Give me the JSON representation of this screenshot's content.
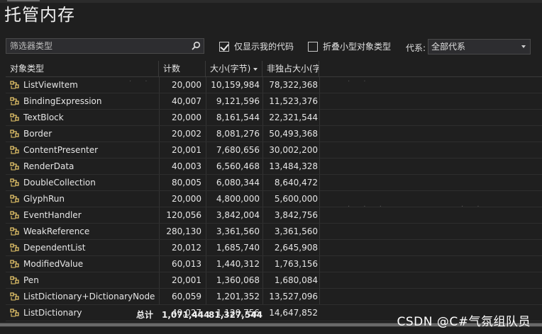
{
  "page": {
    "title": "托管内存"
  },
  "toolbar": {
    "filter_placeholder": "筛选器类型",
    "just_my_code_label": "仅显示我的代码",
    "just_my_code_checked": true,
    "collapse_small_label": "折叠小型对象类型",
    "collapse_small_checked": false,
    "generation_label": "代系:",
    "generation_value": "全部代系"
  },
  "table": {
    "columns": [
      "对象类型",
      "计数",
      "大小(字节)",
      "非独占大小(字"
    ],
    "sorted_column": "大小(字节)",
    "rows": [
      {
        "type": "ListViewItem",
        "count": "20,000",
        "size": "10,159,984",
        "inclusive": "78,322,368"
      },
      {
        "type": "BindingExpression",
        "count": "40,007",
        "size": "9,121,596",
        "inclusive": "11,523,376"
      },
      {
        "type": "TextBlock",
        "count": "20,000",
        "size": "8,161,544",
        "inclusive": "22,321,544"
      },
      {
        "type": "Border",
        "count": "20,002",
        "size": "8,081,276",
        "inclusive": "50,493,368"
      },
      {
        "type": "ContentPresenter",
        "count": "20,001",
        "size": "7,680,656",
        "inclusive": "30,002,200"
      },
      {
        "type": "RenderData",
        "count": "40,003",
        "size": "6,560,468",
        "inclusive": "13,484,328"
      },
      {
        "type": "DoubleCollection",
        "count": "80,005",
        "size": "6,080,344",
        "inclusive": "8,640,472"
      },
      {
        "type": "GlyphRun",
        "count": "20,000",
        "size": "4,800,000",
        "inclusive": "5,600,000"
      },
      {
        "type": "EventHandler",
        "count": "120,056",
        "size": "3,842,004",
        "inclusive": "3,842,756"
      },
      {
        "type": "WeakReference",
        "count": "280,130",
        "size": "3,361,560",
        "inclusive": "3,361,560"
      },
      {
        "type": "DependentList",
        "count": "20,012",
        "size": "1,685,740",
        "inclusive": "2,645,908"
      },
      {
        "type": "ModifiedValue",
        "count": "60,013",
        "size": "1,440,312",
        "inclusive": "1,763,156"
      },
      {
        "type": "Pen",
        "count": "20,001",
        "size": "1,360,068",
        "inclusive": "1,680,084"
      },
      {
        "type": "ListDictionary+DictionaryNode",
        "count": "60,059",
        "size": "1,201,352",
        "inclusive": "13,527,096"
      },
      {
        "type": "ListDictionary",
        "count": "40,027",
        "size": "1,120,756",
        "inclusive": "14,647,852"
      }
    ],
    "total_label": "总计",
    "total_count": "1,071,444",
    "total_size": "81,327,544"
  },
  "watermark": "CSDN @C#气氛组队员",
  "colors": {
    "background": "#1f1f1f",
    "text": "#e6e6e6",
    "border": "#3a3a3a"
  }
}
